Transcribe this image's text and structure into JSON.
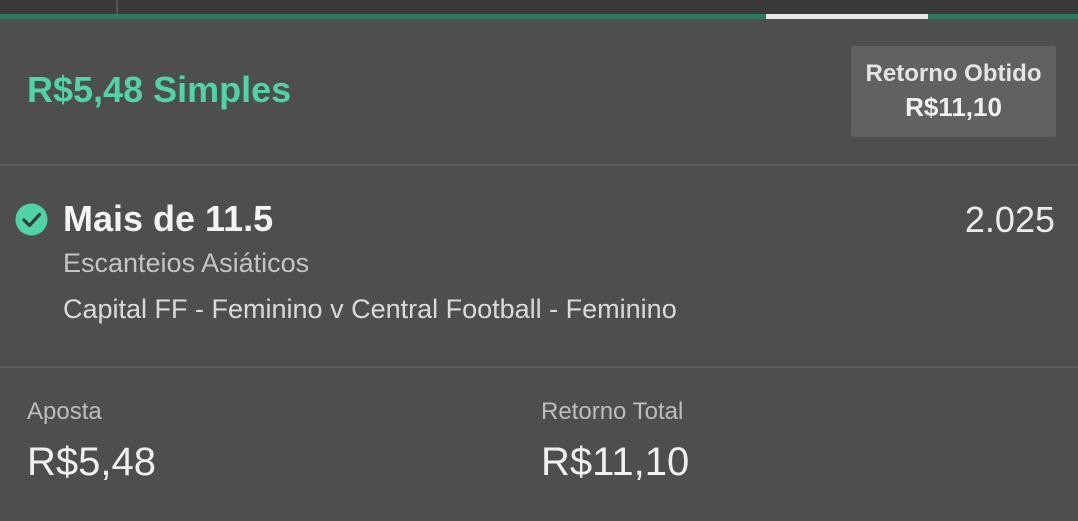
{
  "header": {
    "bet_title": "R$5,48 Simples",
    "cashout": {
      "label": "Retorno Obtido",
      "value": "R$11,10"
    }
  },
  "selection": {
    "status_icon": "check-circle-icon",
    "name": "Mais de 11.5",
    "odds": "2.025",
    "market": "Escanteios Asiáticos",
    "event": "Capital FF - Feminino v Central Football - Feminino"
  },
  "summary": {
    "stake_label": "Aposta",
    "stake_value": "R$5,48",
    "total_return_label": "Retorno Total",
    "total_return_value": "R$11,10"
  },
  "colors": {
    "accent": "#4fd4a5",
    "tab_underline": "#2f7a5e",
    "background": "#4e4e4e"
  }
}
